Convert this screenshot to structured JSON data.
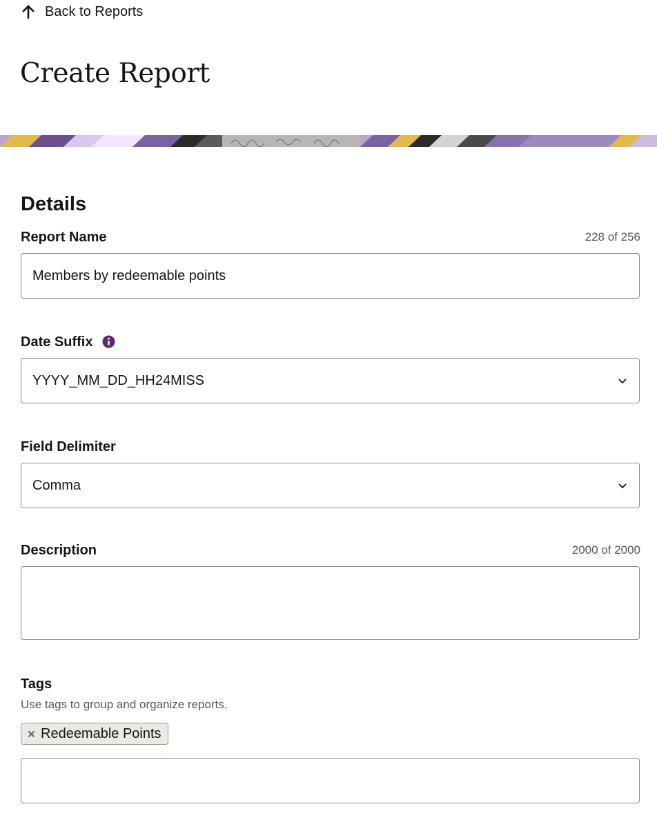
{
  "nav": {
    "back_label": "Back to Reports"
  },
  "page": {
    "title": "Create Report",
    "section_title": "Details"
  },
  "form": {
    "report_name": {
      "label": "Report Name",
      "counter": "228 of 256",
      "value": "Members by redeemable points"
    },
    "date_suffix": {
      "label": "Date Suffix",
      "value": "YYYY_MM_DD_HH24MISS"
    },
    "field_delimiter": {
      "label": "Field Delimiter",
      "value": "Comma"
    },
    "description": {
      "label": "Description",
      "counter": "2000 of 2000",
      "value": ""
    },
    "tags": {
      "label": "Tags",
      "help": "Use tags to group and organize reports.",
      "chips": [
        "Redeemable Points"
      ],
      "input_value": ""
    }
  },
  "colors": {
    "accent": "#5b2a73",
    "border": "#8f8a85",
    "muted_text": "#5b5652",
    "chip_bg": "#ece9e5"
  },
  "icons": {
    "back": "arrow-up-icon",
    "info": "info-icon",
    "dropdown": "chevron-down-icon",
    "remove_tag": "close-icon"
  }
}
